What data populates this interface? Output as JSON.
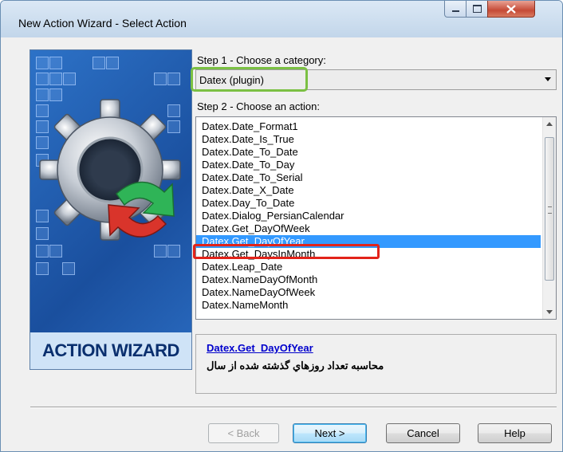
{
  "window": {
    "title": "New Action Wizard - Select Action",
    "buttons": {
      "minimize_icon": "minimize-icon",
      "maximize_icon": "maximize-icon",
      "close_icon": "close-icon"
    }
  },
  "banner": {
    "caption": "ACTION WIZARD",
    "icon": "gear-with-arrows-icon"
  },
  "step1": {
    "label": "Step 1 - Choose a category:",
    "selected": "Datex (plugin)"
  },
  "step2": {
    "label": "Step 2 - Choose an action:",
    "items": [
      "Datex.Date_Format1",
      "Datex.Date_Is_True",
      "Datex.Date_To_Date",
      "Datex.Date_To_Day",
      "Datex.Date_To_Serial",
      "Datex.Date_X_Date",
      "Datex.Day_To_Date",
      "Datex.Dialog_PersianCalendar",
      "Datex.Get_DayOfWeek",
      "Datex.Get_DayOfYear",
      "Datex.Get_DaysInMonth",
      "Datex.Leap_Date",
      "Datex.NameDayOfMonth",
      "Datex.NameDayOfWeek",
      "Datex.NameMonth"
    ],
    "selected_index": 9
  },
  "description": {
    "link": "Datex.Get_DayOfYear",
    "text": "محاسبه تعداد روزهاي گذشته شده از سال"
  },
  "footer": {
    "back": "< Back",
    "next": "Next >",
    "cancel": "Cancel",
    "help": "Help"
  },
  "colors": {
    "highlight_green": "#7bc043",
    "highlight_red": "#e2231a",
    "selection": "#3399ff"
  }
}
